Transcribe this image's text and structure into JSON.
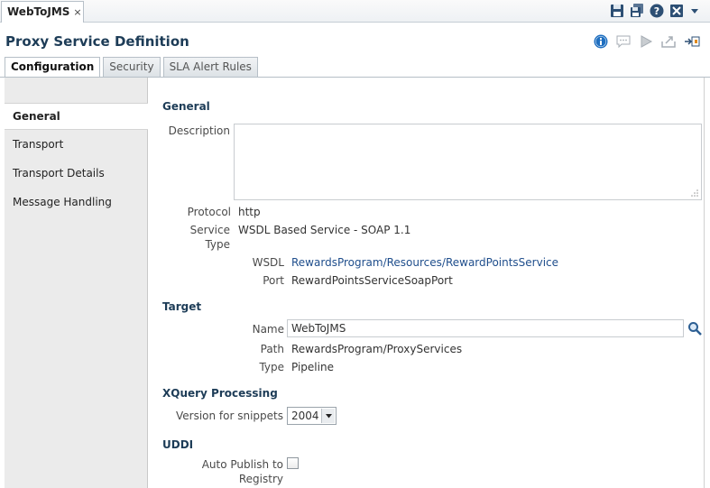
{
  "window": {
    "tab_title": "WebToJMS",
    "tab_close": "×",
    "toolbar_icons": [
      "save-icon",
      "save-all-icon",
      "help-icon",
      "close-all-icon",
      "dropdown-arrow-icon"
    ]
  },
  "header": {
    "title": "Proxy Service Definition",
    "icons": [
      "info-icon",
      "comment-icon",
      "run-icon",
      "export-icon",
      "launch-test-icon"
    ]
  },
  "tabs": [
    {
      "label": "Configuration",
      "active": true
    },
    {
      "label": "Security",
      "active": false
    },
    {
      "label": "SLA Alert Rules",
      "active": false
    }
  ],
  "sidebar": {
    "items": [
      {
        "label": "General",
        "active": true
      },
      {
        "label": "Transport",
        "active": false
      },
      {
        "label": "Transport Details",
        "active": false
      },
      {
        "label": "Message Handling",
        "active": false
      }
    ]
  },
  "general": {
    "heading": "General",
    "description_label": "Description",
    "description_value": "",
    "protocol_label": "Protocol",
    "protocol_value": "http",
    "service_type_label_1": "Service",
    "service_type_label_2": "Type",
    "service_type_value": "WSDL Based Service - SOAP 1.1",
    "wsdl_label": "WSDL",
    "wsdl_value": "RewardsProgram/Resources/RewardPointsService",
    "port_label": "Port",
    "port_value": "RewardPointsServiceSoapPort"
  },
  "target": {
    "heading": "Target",
    "name_label": "Name",
    "name_value": "WebToJMS",
    "path_label": "Path",
    "path_value": "RewardsProgram/ProxyServices",
    "type_label": "Type",
    "type_value": "Pipeline"
  },
  "xquery": {
    "heading": "XQuery Processing",
    "version_label": "Version for snippets",
    "version_value": "2004"
  },
  "uddi": {
    "heading": "UDDI",
    "auto_publish_label_1": "Auto Publish to",
    "auto_publish_label_2": "Registry",
    "auto_publish_checked": false
  },
  "colors": {
    "heading": "#1d3c57",
    "link": "#1f4e8c",
    "sidebar_bg": "#ebebeb"
  }
}
